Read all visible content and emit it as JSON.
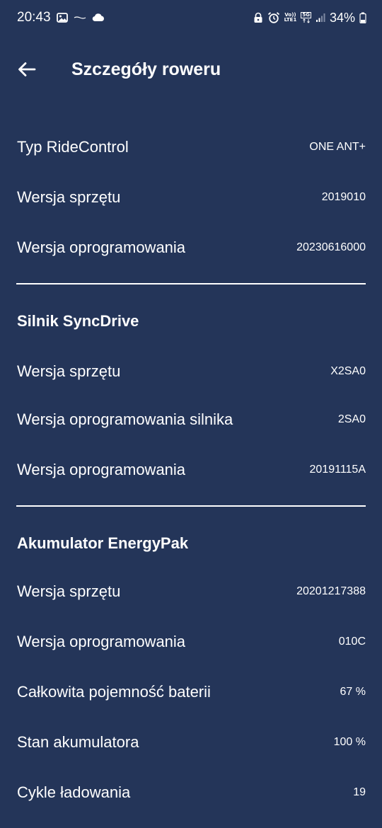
{
  "status_bar": {
    "time": "20:43",
    "network_top": "Vo))",
    "network_bottom": "LTE1",
    "fiveg": "5G",
    "battery": "34%"
  },
  "header": {
    "title": "Szczegóły roweru"
  },
  "ride_control": {
    "rows": [
      {
        "label": "Typ RideControl",
        "value": "ONE ANT+"
      },
      {
        "label": "Wersja sprzętu",
        "value": "2019010"
      },
      {
        "label": "Wersja oprogramowania",
        "value": "20230616000"
      }
    ]
  },
  "motor": {
    "title": "Silnik SyncDrive",
    "rows": [
      {
        "label": "Wersja sprzętu",
        "value": "X2SA0"
      },
      {
        "label": "Wersja oprogramowania silnika",
        "value": "2SA0"
      },
      {
        "label": "Wersja oprogramowania",
        "value": "20191115A"
      }
    ]
  },
  "battery": {
    "title": "Akumulator EnergyPak",
    "rows": [
      {
        "label": "Wersja sprzętu",
        "value": "20201217388"
      },
      {
        "label": "Wersja oprogramowania",
        "value": "010C"
      },
      {
        "label": "Całkowita pojemność baterii",
        "value": "67 %"
      },
      {
        "label": "Stan akumulatora",
        "value": "100 %"
      },
      {
        "label": "Cykle ładowania",
        "value": "19"
      }
    ]
  },
  "colors": {
    "background": "#243559",
    "text": "#ffffff"
  }
}
